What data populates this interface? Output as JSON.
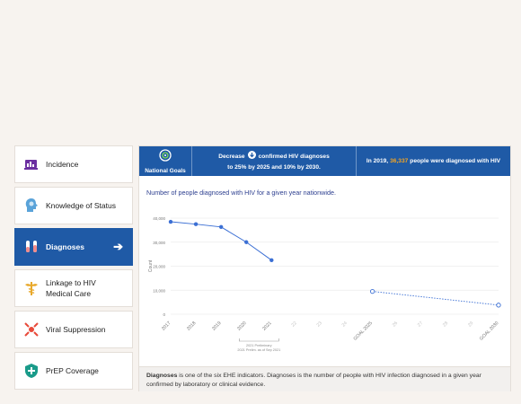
{
  "sidebar": {
    "items": [
      {
        "label": "Incidence",
        "icon": "incidence-icon"
      },
      {
        "label": "Knowledge of Status",
        "icon": "head-icon"
      },
      {
        "label": "Diagnoses",
        "icon": "test-tubes-icon",
        "active": true
      },
      {
        "label": "Linkage to HIV",
        "label2": "Medical Care",
        "icon": "medical-caduceus-icon"
      },
      {
        "label": "Viral Suppression",
        "icon": "virus-icon"
      },
      {
        "label": "PrEP Coverage",
        "icon": "shield-plus-icon"
      }
    ]
  },
  "banner": {
    "national_goals": "National Goals",
    "goal_prefix": "Decrease",
    "goal_suffix": "confirmed HIV diagnoses",
    "goal_line2": "to 25% by 2025 and 10% by 2030.",
    "stat_prefix": "In 2019,",
    "stat_value": "36,337",
    "stat_suffix": "people were diagnosed with HIV"
  },
  "subtitle": "Number of people diagnosed with HIV for a given year nationwide.",
  "footer": {
    "term": "Diagnoses",
    "text": " is one of the six EHE indicators. Diagnoses is the number of people with HIV infection diagnosed in a given year confirmed by laboratory or clinical evidence."
  },
  "colors": {
    "primary": "#1f5aa6",
    "accent": "#f5a623",
    "line": "#3b6fd4"
  },
  "chart_data": {
    "type": "line",
    "ylabel": "Count",
    "yticks": [
      "0",
      "10,000",
      "20,000",
      "30,000",
      "40,000"
    ],
    "ylim": [
      0,
      40000
    ],
    "categories": [
      "2017",
      "2018",
      "2019",
      "2020",
      "2021",
      "22",
      "23",
      "24",
      "GOAL 2025",
      "26",
      "27",
      "28",
      "29",
      "GOAL 2030"
    ],
    "series": [
      {
        "name": "actual",
        "x": [
          "2017",
          "2018",
          "2019",
          "2020",
          "2021"
        ],
        "values": [
          38500,
          37500,
          36337,
          30000,
          22500
        ]
      },
      {
        "name": "goal",
        "x": [
          "GOAL 2025",
          "GOAL 2030"
        ],
        "values": [
          9500,
          3800
        ]
      }
    ],
    "annotation": "2021 Preliminary",
    "annotation2": "2021 Prelim. as of Sep 2021",
    "grid": true
  }
}
